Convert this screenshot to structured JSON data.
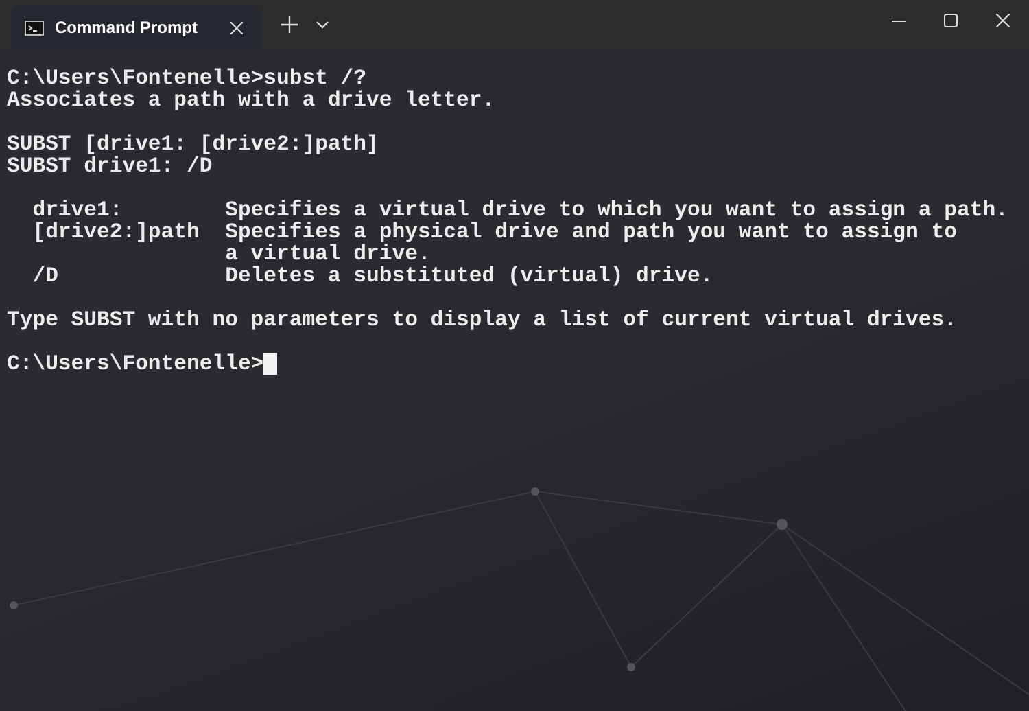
{
  "tabs": [
    {
      "title": "Command Prompt",
      "selected": true
    }
  ],
  "terminal": {
    "blocks": [
      [
        "C:\\Users\\Fontenelle>subst /?",
        "Associates a path with a drive letter."
      ],
      [
        "SUBST [drive1: [drive2:]path]",
        "SUBST drive1: /D"
      ],
      [
        "  drive1:        Specifies a virtual drive to which you want to assign a path.",
        "  [drive2:]path  Specifies a physical drive and path you want to assign to",
        "                 a virtual drive.",
        "  /D             Deletes a substituted (virtual) drive."
      ],
      [
        "Type SUBST with no parameters to display a list of current virtual drives."
      ],
      [
        "C:\\Users\\Fontenelle>"
      ]
    ]
  }
}
